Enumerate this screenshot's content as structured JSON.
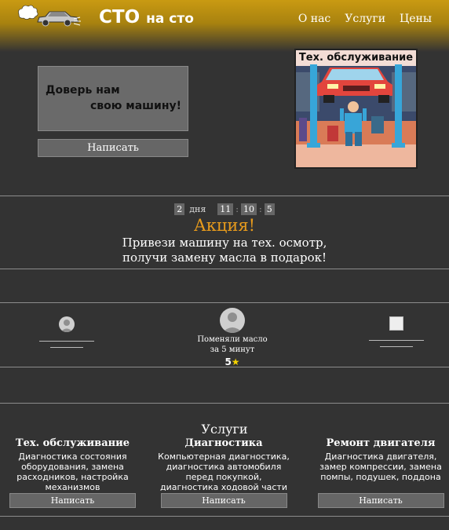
{
  "header": {
    "logo_main": "СТО",
    "logo_small": "на сто",
    "nav": [
      "О нас",
      "Услуги",
      "Цены"
    ]
  },
  "hero": {
    "line1": "Доверь нам",
    "line2": "свою машину!",
    "write_button": "Написать",
    "promo_image_title": "Тех. обслуживание"
  },
  "promo": {
    "days": "2",
    "days_label": "дня",
    "hours": "11",
    "minutes": "10",
    "seconds": "5",
    "separator": ":",
    "title": "Акция!",
    "text_line1": "Привези машину на тех. осмотр,",
    "text_line2": "получи замену масла в подарок!"
  },
  "reviews": {
    "center": {
      "line1": "Поменяли масло",
      "line2": "за 5 минут",
      "rating": "5",
      "star": "★"
    }
  },
  "services": {
    "title": "Услуги",
    "items": [
      {
        "title": "Тех. обслуживание",
        "lines": [
          "Диагностика состояния",
          "оборудования, замена",
          "расходников, настройка",
          "механизмов"
        ],
        "button": "Написать"
      },
      {
        "title": "Диагностика",
        "lines": [
          "Компьютерная диагностика,",
          "диагностика автомобиля",
          "перед покупкой,",
          "диагностика ходовой части"
        ],
        "button": "Написать"
      },
      {
        "title": "Ремонт двигателя",
        "lines": [
          "Диагностика двигателя,",
          "замер компрессии, замена",
          "помпы, подушек, поддона"
        ],
        "button": "Написать"
      }
    ]
  },
  "colors": {
    "accent": "#e89b1c",
    "header_gold": "#c99a12",
    "background": "#333333",
    "star": "#f5d300"
  }
}
